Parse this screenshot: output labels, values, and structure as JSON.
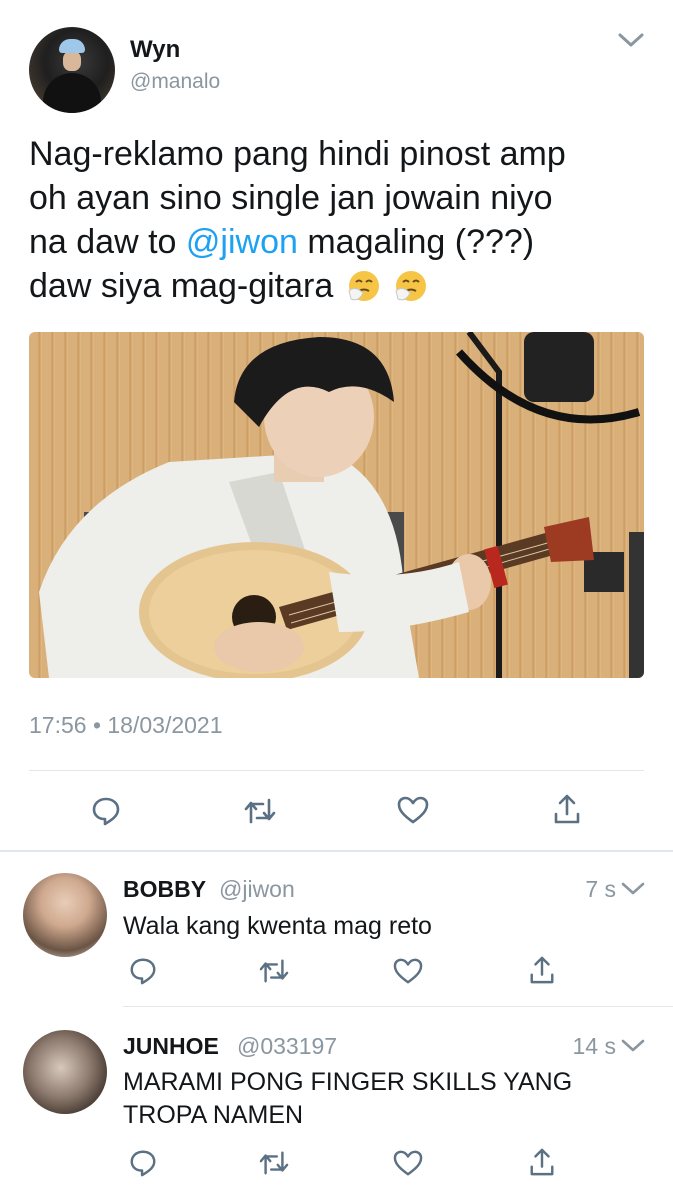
{
  "main": {
    "name": "Wyn",
    "handle": "@manalo",
    "text_parts": {
      "line1": "Nag-reklamo pang hindi pinost amp",
      "line2": "oh ayan sino single jan jowain niyo",
      "line3_pre": "na daw to ",
      "mention": "@jiwon",
      "line3_post": " magaling (???)",
      "line4": "daw siya mag-gitara"
    },
    "emoji": [
      "sneezing-face",
      "sneezing-face"
    ],
    "timestamp": "17:56 • 18/03/2021",
    "actions": [
      "reply-icon",
      "retweet-icon",
      "like-icon",
      "share-icon"
    ]
  },
  "replies": [
    {
      "name": "BOBBY",
      "handle": "@jiwon",
      "time": "7 s",
      "text": "Wala kang kwenta mag reto"
    },
    {
      "name": "JUNHOE",
      "handle": "@033197",
      "time": "14 s",
      "text": "MARAMI PONG FINGER SKILLS YANG TROPA NAMEN"
    }
  ],
  "colors": {
    "text": "#14171a",
    "secondary": "#8a96a0",
    "mention": "#1da1f2",
    "icon": "#5b7083",
    "divider": "#e1e8ed"
  }
}
